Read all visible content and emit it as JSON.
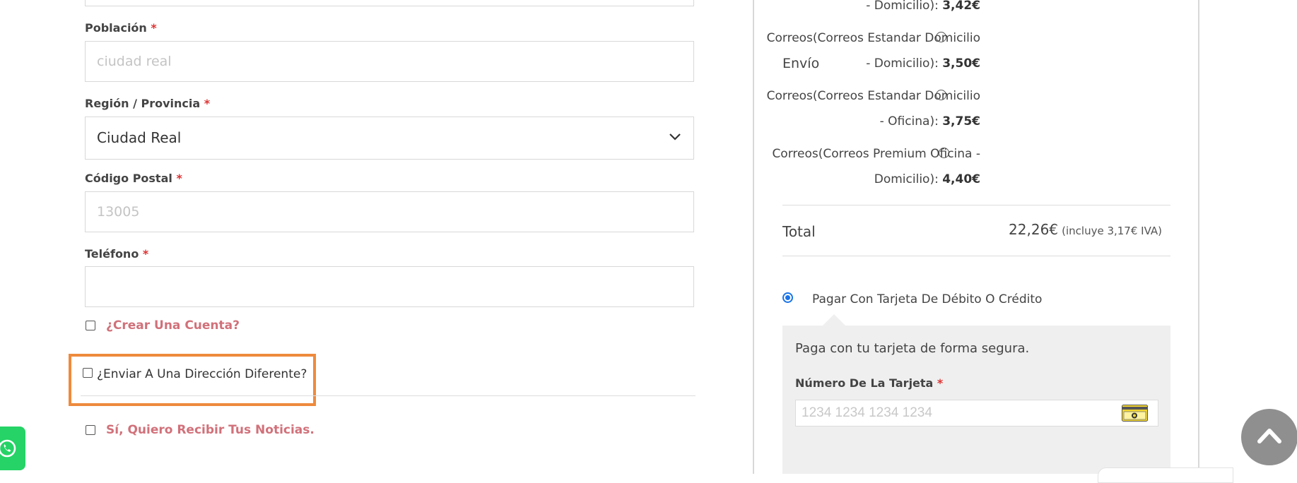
{
  "billing_form": {
    "poblacion": {
      "label": "Población",
      "required_mark": "*",
      "placeholder": "ciudad real",
      "value": ""
    },
    "region": {
      "label": "Región / Provincia",
      "required_mark": "*",
      "selected": "Ciudad Real"
    },
    "codigo_postal": {
      "label": "Código Postal",
      "required_mark": "*",
      "placeholder": "13005",
      "value": ""
    },
    "telefono": {
      "label": "Teléfono",
      "required_mark": "*",
      "value": ""
    },
    "create_account_label": "¿Crear Una Cuenta?",
    "ship_different_label": "¿Enviar A Una Dirección Diferente?",
    "newsletter_label": "Sí, Quiero Recibir Tus Noticias."
  },
  "order_summary": {
    "shipping_label": "Envío",
    "shipping_options": [
      {
        "line1": "",
        "line2_text": "- Domicilio): ",
        "price": "3,42€"
      },
      {
        "line1": "Correos(Correos Estandar Domicilio",
        "line2_text": "- Domicilio): ",
        "price": "3,50€"
      },
      {
        "line1": "Correos(Correos Estandar Domicilio",
        "line2_text": "- Oficina): ",
        "price": "3,75€"
      },
      {
        "line1": "Correos(Correos Premium Oficina -",
        "line2_text": "Domicilio): ",
        "price": "4,40€"
      }
    ],
    "total_label": "Total",
    "total_value": "22,26€",
    "total_tax_note": "(incluye 3,17€ IVA)"
  },
  "payment": {
    "method_label": "Pagar Con Tarjeta De Débito O Crédito",
    "description": "Paga con tu tarjeta de forma segura.",
    "card_number_label": "Número De La Tarjeta",
    "required_mark": "*",
    "card_number_placeholder": "1234 1234 1234 1234"
  },
  "colors": {
    "required": "#dd3333",
    "link_red": "#d1717a",
    "highlight_orange": "#ee8a3c",
    "radio_selected": "#1a73e8",
    "scroll_button": "#8f8f8f",
    "whatsapp_green": "#25d366"
  },
  "icons": [
    "chevron-down-icon",
    "credit-card-icon",
    "chevron-up-icon",
    "whatsapp-icon"
  ]
}
